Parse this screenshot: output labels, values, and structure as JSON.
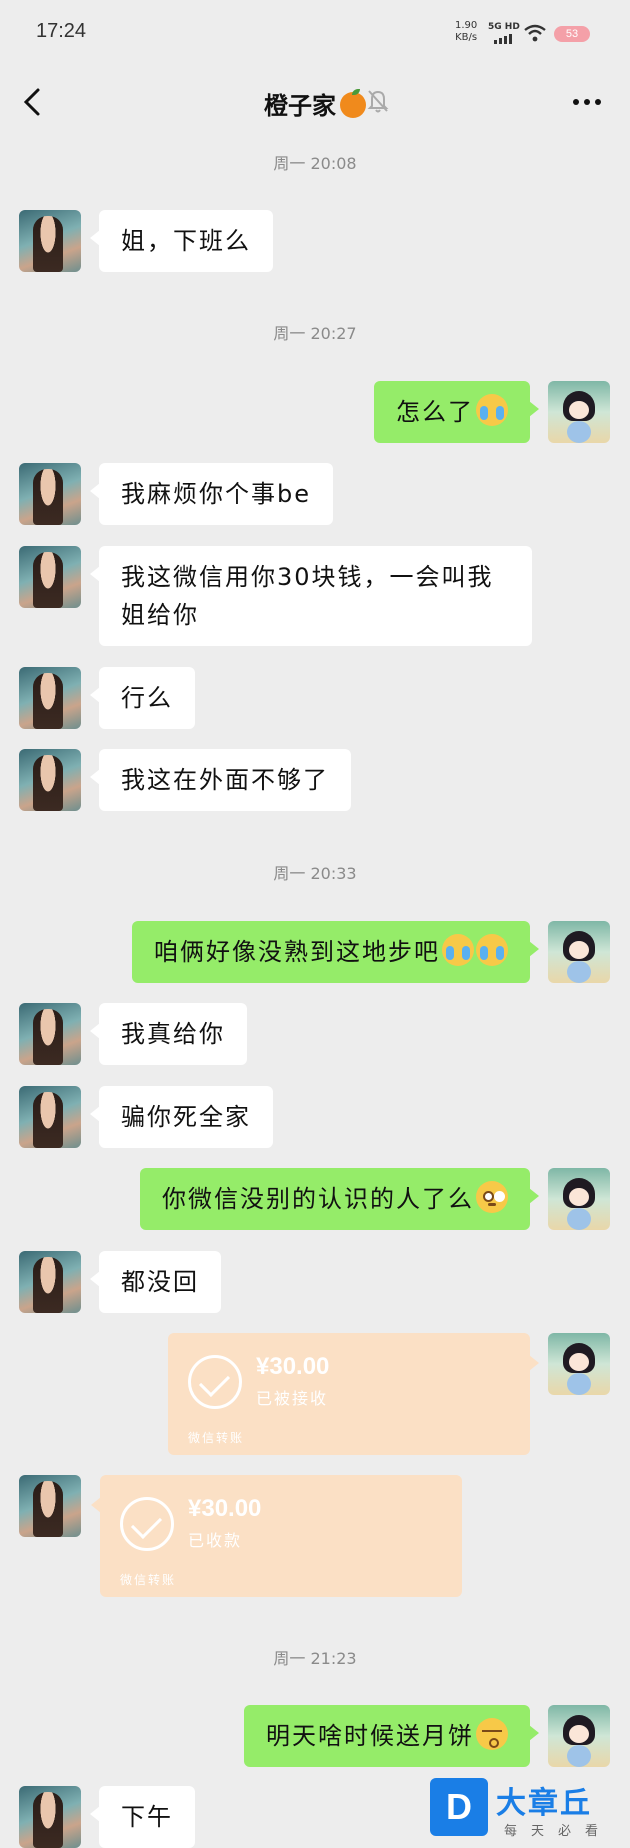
{
  "status_bar": {
    "time": "17:24",
    "net_speed": "1.90",
    "net_unit": "KB/s",
    "network": "5G HD",
    "battery": "53",
    "icons": [
      "signal-icon",
      "wifi-icon",
      "battery-icon"
    ]
  },
  "header": {
    "title": "橙子家",
    "icons": [
      "back-icon",
      "orange-emoji-icon",
      "mute-bell-icon",
      "more-icon"
    ]
  },
  "messages": [
    {
      "type": "time",
      "text": "周一 20:08"
    },
    {
      "type": "text",
      "from": "her",
      "text": "姐，下班么"
    },
    {
      "type": "time",
      "text": "周一 20:27"
    },
    {
      "type": "text",
      "from": "me",
      "text": "怎么了",
      "emoji": "cry-laugh-emoji-icon"
    },
    {
      "type": "text",
      "from": "her",
      "text": "我麻烦你个事be"
    },
    {
      "type": "text",
      "from": "her",
      "text": "我这微信用你30块钱，一会叫我姐给你"
    },
    {
      "type": "text",
      "from": "her",
      "text": "行么"
    },
    {
      "type": "text",
      "from": "her",
      "text": "我这在外面不够了"
    },
    {
      "type": "time",
      "text": "周一 20:33"
    },
    {
      "type": "text",
      "from": "me",
      "text": "咱俩好像没熟到这地步吧",
      "emoji": "cry-laugh-emoji-icon x2"
    },
    {
      "type": "text",
      "from": "her",
      "text": "我真给你"
    },
    {
      "type": "text",
      "from": "her",
      "text": "骗你死全家"
    },
    {
      "type": "text",
      "from": "me",
      "text": "你微信没别的认识的人了么",
      "emoji": "dazed-emoji-icon"
    },
    {
      "type": "text",
      "from": "her",
      "text": "都没回"
    },
    {
      "type": "transfer",
      "from": "me",
      "amount": "¥30.00",
      "status": "已被接收",
      "footer": "微信转账"
    },
    {
      "type": "transfer",
      "from": "her",
      "amount": "¥30.00",
      "status": "已收款",
      "footer": "微信转账"
    },
    {
      "type": "time",
      "text": "周一 21:23"
    },
    {
      "type": "text",
      "from": "me",
      "text": "明天啥时候送月饼",
      "emoji": "kiss-emoji-icon"
    },
    {
      "type": "text",
      "from": "her",
      "text": "下午"
    }
  ],
  "watermark": {
    "logo_letter": "D",
    "name": "大章丘",
    "slogan": "每天必看"
  },
  "colors": {
    "background": "#ededed",
    "bubble_in": "#ffffff",
    "bubble_out": "#95ec69",
    "transfer_done": "#fbe0c5",
    "watermark_blue": "#1a7ee6"
  }
}
